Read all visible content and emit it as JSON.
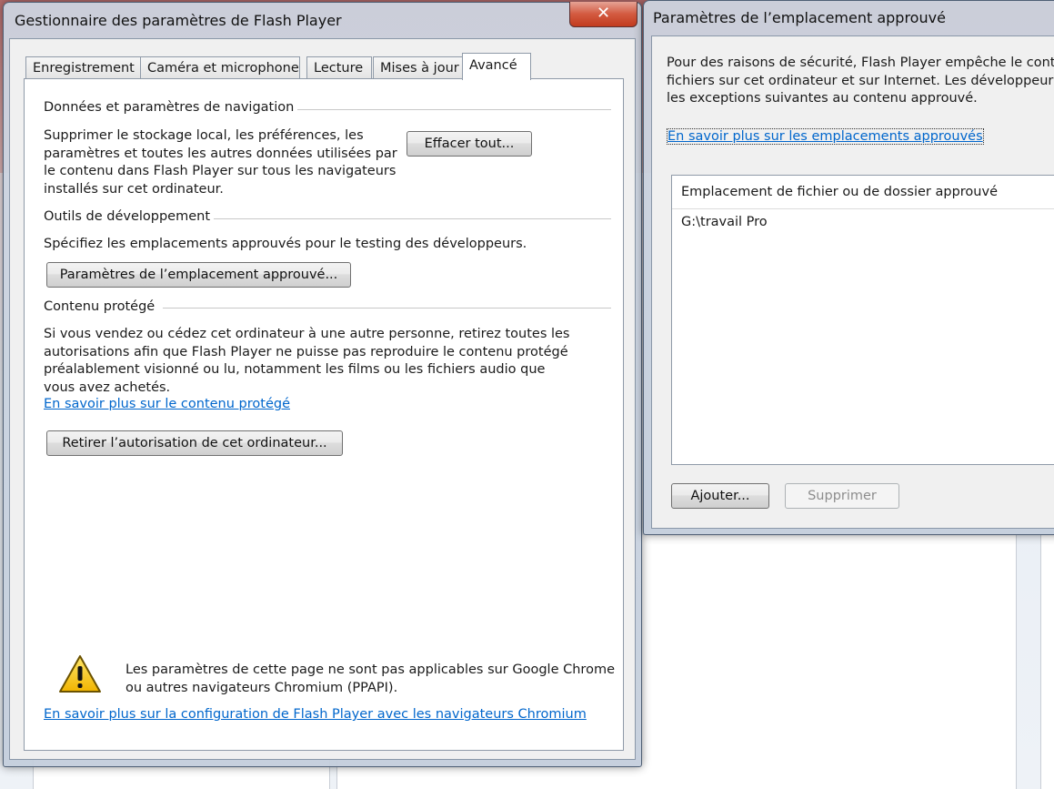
{
  "main_window": {
    "title": "Gestionnaire des paramètres de Flash Player",
    "close_label": "✕",
    "tabs": [
      {
        "label": "Enregistrement"
      },
      {
        "label": "Caméra et microphone"
      },
      {
        "label": "Lecture"
      },
      {
        "label": "Mises à jour"
      },
      {
        "label": "Avancé"
      }
    ],
    "browsing": {
      "heading": "Données et paramètres de navigation",
      "text": "Supprimer le stockage local, les préférences, les paramètres et toutes les autres données utilisées par le contenu dans Flash Player sur tous les navigateurs installés sur cet ordinateur.",
      "clear_button": "Effacer tout..."
    },
    "dev_tools": {
      "heading": "Outils de développement",
      "text": "Spécifiez les emplacements approuvés pour le testing des développeurs.",
      "button": "Paramètres de l’emplacement approuvé..."
    },
    "protected": {
      "heading": "Contenu protégé",
      "text": "Si vous vendez ou cédez cet ordinateur à une autre personne, retirez toutes les autorisations afin que Flash Player ne puisse pas reproduire le contenu protégé préalablement visionné ou lu, notamment les films ou les fichiers audio que vous avez achetés.",
      "link": "En savoir plus sur le contenu protégé",
      "button": "Retirer l’autorisation de cet ordinateur..."
    },
    "warning": {
      "text": "Les paramètres de cette page ne sont pas applicables sur Google Chrome ou autres navigateurs Chromium (PPAPI).",
      "link": "En savoir plus sur la configuration de Flash Player avec les navigateurs Chromium"
    }
  },
  "approved_window": {
    "title": "Paramètres de l’emplacement approuvé",
    "intro_line1": "Pour des raisons de sécurité, Flash Player empêche le conte",
    "intro_line2": "fichiers sur cet ordinateur et sur Internet. Les développeurs",
    "intro_line3": "les exceptions suivantes au contenu approuvé.",
    "link": "En savoir plus sur les emplacements approuvés",
    "list_header": "Emplacement de fichier ou de dossier approuvé",
    "list_items": [
      "G:\\travail Pro"
    ],
    "add_button": "Ajouter...",
    "remove_button": "Supprimer"
  }
}
